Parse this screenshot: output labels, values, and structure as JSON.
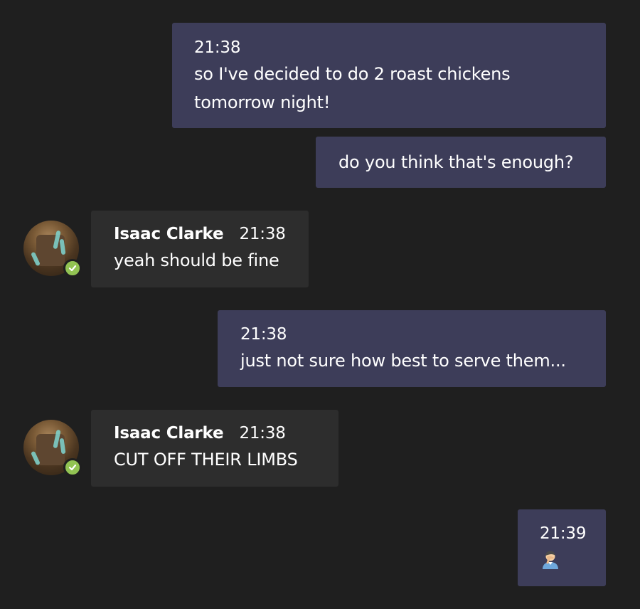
{
  "messages": [
    {
      "side": "me",
      "time": "21:38",
      "lines": [
        "so I've decided to do 2 roast chickens",
        "tomorrow night!"
      ]
    },
    {
      "side": "me",
      "time": "",
      "lines": [
        "do you think that's enough?"
      ]
    },
    {
      "side": "them",
      "sender": "Isaac Clarke",
      "time": "21:38",
      "text": "yeah should be fine"
    },
    {
      "side": "me",
      "time": "21:38",
      "lines": [
        "just not sure how best to serve them..."
      ]
    },
    {
      "side": "them",
      "sender": "Isaac Clarke",
      "time": "21:38",
      "text": "CUT OFF THEIR LIMBS"
    },
    {
      "side": "me",
      "time": "21:39",
      "emoji": "man-facepalming-emoji"
    }
  ],
  "presence": {
    "status": "available",
    "color": "#92c353"
  },
  "colors": {
    "background": "#1f1f1f",
    "my_bubble": "#3d3d59",
    "their_bubble": "#2d2d2d"
  }
}
